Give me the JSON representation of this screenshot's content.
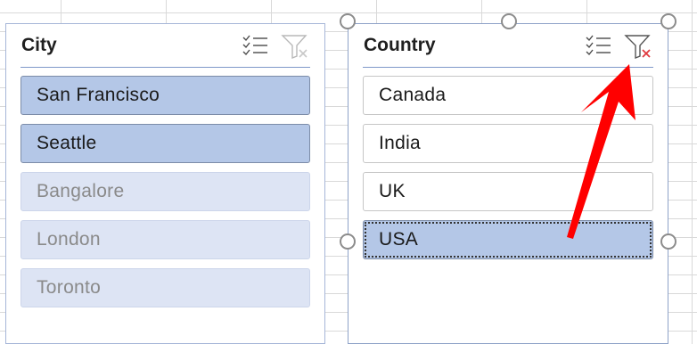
{
  "slicers": [
    {
      "title": "City",
      "items": [
        {
          "label": "San Francisco",
          "state": "selected"
        },
        {
          "label": "Seattle",
          "state": "selected"
        },
        {
          "label": "Bangalore",
          "state": "no-data"
        },
        {
          "label": "London",
          "state": "no-data"
        },
        {
          "label": "Toronto",
          "state": "no-data"
        }
      ],
      "icons": {
        "multi_select": "multi-select-icon",
        "clear_filter": "clear-filter-icon"
      },
      "clear_filter_active": false
    },
    {
      "title": "Country",
      "items": [
        {
          "label": "Canada",
          "state": "unselected"
        },
        {
          "label": "India",
          "state": "unselected"
        },
        {
          "label": "UK",
          "state": "unselected"
        },
        {
          "label": "USA",
          "state": "selected"
        }
      ],
      "icons": {
        "multi_select": "multi-select-icon",
        "clear_filter": "clear-filter-icon"
      },
      "clear_filter_active": true
    }
  ],
  "colors": {
    "selected_item": "#b4c7e7",
    "no_data_item": "#dde4f4",
    "header_rule": "#7f98c9",
    "annotation_arrow": "#ff0000",
    "clear_filter_x": "#e0393e"
  }
}
